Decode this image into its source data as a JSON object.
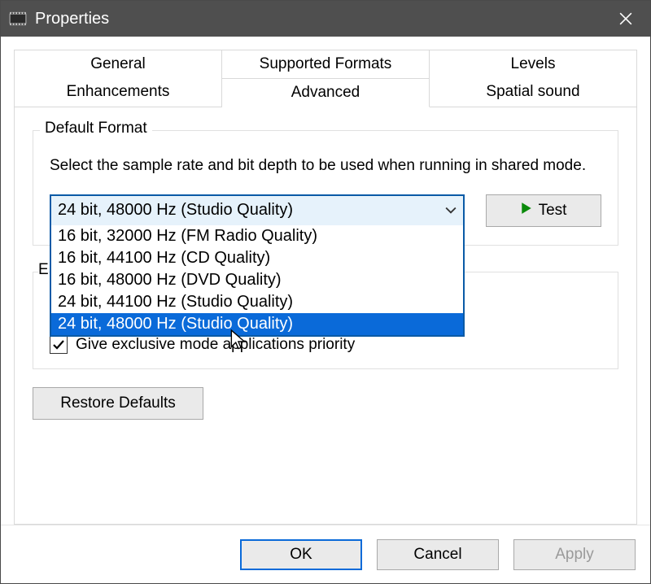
{
  "window": {
    "title": "Properties"
  },
  "tabs": {
    "row1": [
      "General",
      "Supported Formats",
      "Levels"
    ],
    "row2": [
      "Enhancements",
      "Advanced",
      "Spatial sound"
    ],
    "active": "Advanced"
  },
  "default_format": {
    "legend": "Default Format",
    "help": "Select the sample rate and bit depth to be used when running in shared mode.",
    "selected": "24 bit, 48000 Hz (Studio Quality)",
    "options": [
      "16 bit, 32000 Hz (FM Radio Quality)",
      "16 bit, 44100 Hz (CD Quality)",
      "16 bit, 48000 Hz (DVD Quality)",
      "24 bit, 44100 Hz (Studio Quality)",
      "24 bit, 48000 Hz (Studio Quality)"
    ],
    "selected_index": 4,
    "test_label": "Test"
  },
  "exclusive": {
    "peek_letter": "E",
    "checkbox_label": "Give exclusive mode applications priority",
    "checkbox_checked": true
  },
  "restore_label": "Restore Defaults",
  "buttons": {
    "ok": "OK",
    "cancel": "Cancel",
    "apply": "Apply"
  }
}
